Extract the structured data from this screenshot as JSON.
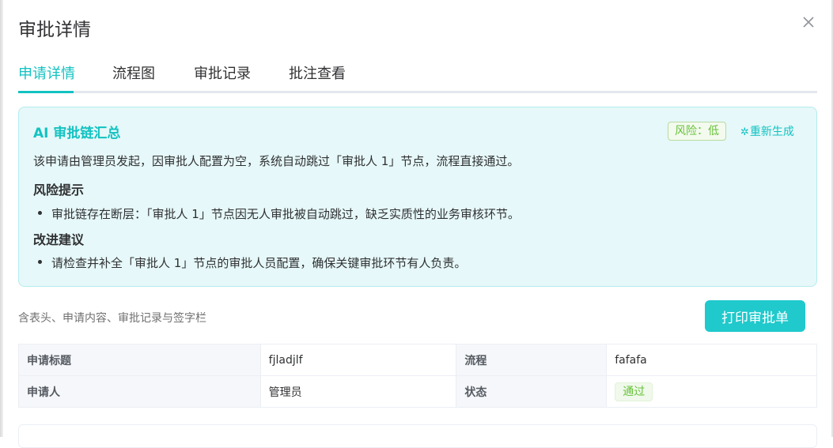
{
  "dialog": {
    "title": "审批详情"
  },
  "tabs": [
    {
      "label": "申请详情",
      "active": true
    },
    {
      "label": "流程图",
      "active": false
    },
    {
      "label": "审批记录",
      "active": false
    },
    {
      "label": "批注查看",
      "active": false
    }
  ],
  "ai_summary": {
    "title": "AI 审批链汇总",
    "risk_badge": "风险：低",
    "regenerate_label": "重新生成",
    "summary": "该申请由管理员发起，因审批人配置为空，系统自动跳过「审批人 1」节点，流程直接通过。",
    "risk_heading": "风险提示",
    "risk_items": [
      "审批链存在断层：「审批人 1」节点因无人审批被自动跳过，缺乏实质性的业务审核环节。"
    ],
    "suggest_heading": "改进建议",
    "suggest_items": [
      "请检查并补全「审批人 1」节点的审批人员配置，确保关键审批环节有人负责。"
    ]
  },
  "print": {
    "hint": "含表头、申请内容、审批记录与签字栏",
    "button_label": "打印审批单"
  },
  "info_table": {
    "rows": [
      {
        "label1": "申请标题",
        "value1": "fjladjlf",
        "label2": "流程",
        "value2": "fafafa"
      },
      {
        "label1": "申请人",
        "value1": "管理员",
        "label2": "状态",
        "value2": "通过"
      }
    ]
  },
  "colors": {
    "accent": "#13c2c2",
    "success": "#67c23a",
    "ai_card_bg": "#e6f8f9"
  }
}
